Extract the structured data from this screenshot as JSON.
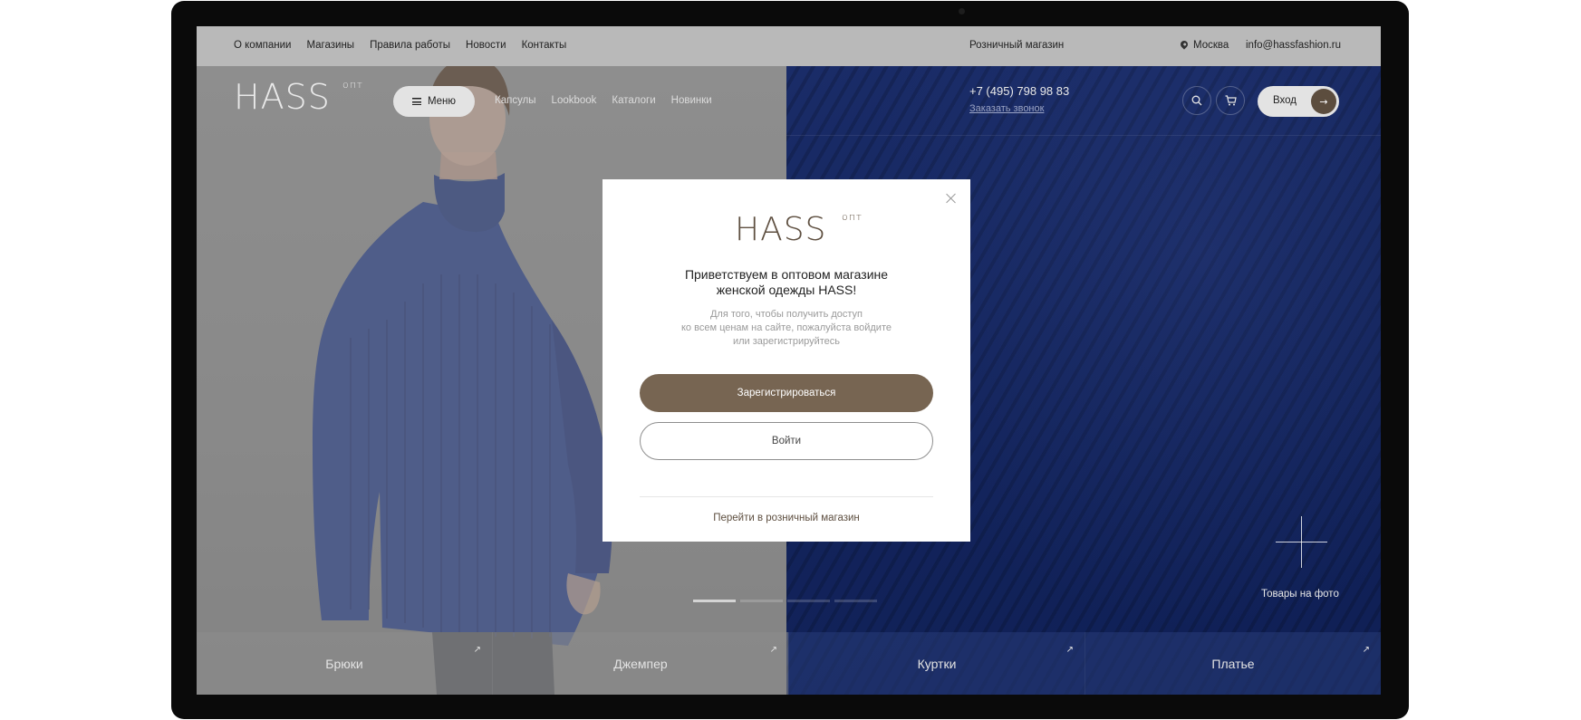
{
  "topbar": {
    "nav": [
      "О компании",
      "Магазины",
      "Правила работы",
      "Новости",
      "Контакты"
    ],
    "retail_label": "Розничный магазин",
    "city": "Москва",
    "email": "info@hassfashion.ru"
  },
  "header": {
    "logo_text": "HASS",
    "logo_sup": "опт",
    "menu_label": "Меню",
    "nav": [
      "Капсулы",
      "Lookbook",
      "Каталоги",
      "Новинки"
    ],
    "phone": "+7 (495) 798 98 83",
    "callback": "Заказать звонок",
    "login_label": "Вход",
    "icons": [
      "search-icon",
      "cart-icon",
      "arrow-right-icon"
    ]
  },
  "hero": {
    "slides_total": 4,
    "active_slide": 1,
    "products_label": "Товары на фото"
  },
  "categories": [
    {
      "label": "Брюки"
    },
    {
      "label": "Джемпер"
    },
    {
      "label": "Куртки"
    },
    {
      "label": "Платье"
    }
  ],
  "modal": {
    "logo_text": "HASS",
    "logo_sup": "опт",
    "title_line1": "Приветствуем в оптовом магазине",
    "title_line2": "женской одежды HASS!",
    "desc_line1": "Для того, чтобы получить доступ",
    "desc_line2": "ко всем ценам на сайте, пожалуйста войдите",
    "desc_line3": "или зарегистрируйтесь",
    "register_label": "Зарегистрироваться",
    "login_label": "Войти",
    "retail_link": "Перейти в розничный магазин"
  },
  "colors": {
    "accent": "#776552",
    "overlay": "#8a8a8a",
    "hero_blue": "#13245c"
  }
}
